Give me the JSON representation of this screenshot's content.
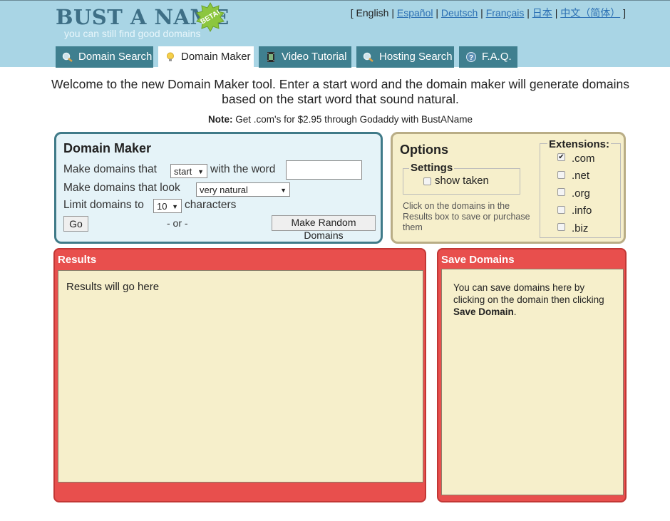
{
  "header": {
    "logo_title": "BUST A NAME",
    "logo_tagline": "you can still find good domains",
    "beta_badge": "BETA!",
    "languages": {
      "open_bracket": "[",
      "close_bracket": "]",
      "separator": "|",
      "items": [
        "English",
        "Español",
        "Deutsch",
        "Français",
        "日本",
        "中文（简体）"
      ]
    }
  },
  "tabs": [
    {
      "label": "Domain Search",
      "icon": "magnifier-icon"
    },
    {
      "label": "Domain Maker",
      "icon": "lightbulb-icon"
    },
    {
      "label": "Video Tutorial",
      "icon": "film-icon"
    },
    {
      "label": "Hosting Search",
      "icon": "magnifier-icon"
    },
    {
      "label": "F.A.Q.",
      "icon": "help-icon"
    }
  ],
  "intro": {
    "welcome": "Welcome to the new Domain Maker tool. Enter a start word and the domain maker will generate domains based on the start word that sound natural.",
    "note_label": "Note:",
    "note_text": "Get .com's for $2.95 through Godaddy with BustAName"
  },
  "domain_maker": {
    "title": "Domain Maker",
    "row1_prefix": "Make domains that",
    "position_select": "start",
    "row1_suffix": "with the word",
    "word_input_value": "",
    "row2_prefix": "Make domains that look",
    "style_select": "very natural",
    "row3_prefix": "Limit domains to",
    "length_select": "10",
    "row3_suffix": "characters",
    "go_button": "Go",
    "or_text": "- or -",
    "random_button": "Make Random Domains"
  },
  "options": {
    "title": "Options",
    "settings_legend": "Settings",
    "show_taken_label": "show taken",
    "hint": "Click on the domains in the Results box to save or purchase them",
    "extensions_legend": "Extensions:",
    "extensions": [
      {
        "label": ".com",
        "checked": true
      },
      {
        "label": ".net",
        "checked": false
      },
      {
        "label": ".org",
        "checked": false
      },
      {
        "label": ".info",
        "checked": false
      },
      {
        "label": ".biz",
        "checked": false
      }
    ]
  },
  "results": {
    "title": "Results",
    "placeholder": "Results will go here"
  },
  "save_domains": {
    "title": "Save Domains",
    "text_before": "You can save domains here by clicking on the domain then clicking",
    "text_bold": "Save Domain",
    "text_after": "."
  },
  "colors": {
    "header_bg": "#a9d5e5",
    "tab_bg": "#3f7f8f",
    "panel_red": "#e84f4d",
    "panel_cream": "#f6efcb",
    "panel_blue": "#e5f3f8",
    "link_blue": "#2a6fb3"
  }
}
